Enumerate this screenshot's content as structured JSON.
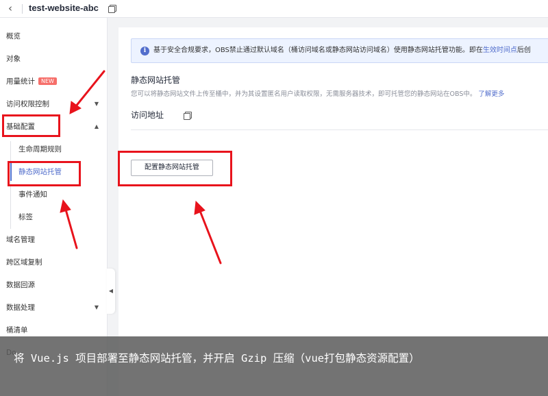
{
  "topbar": {
    "back_glyph": "‹",
    "title": "test-website-abc",
    "copy_icon": "copy-icon"
  },
  "sidebar": {
    "items": [
      {
        "label": "概览"
      },
      {
        "label": "对象"
      },
      {
        "label": "用量统计",
        "badge": "NEW"
      },
      {
        "label": "访问权限控制",
        "caret": "▼"
      },
      {
        "label": "基础配置",
        "caret": "▲"
      },
      {
        "label": "生命周期规则"
      },
      {
        "label": "静态网站托管"
      },
      {
        "label": "事件通知"
      },
      {
        "label": "标签"
      },
      {
        "label": "域名管理"
      },
      {
        "label": "跨区域复制"
      },
      {
        "label": "数据回源"
      },
      {
        "label": "数据处理",
        "caret": "▼"
      },
      {
        "label": "桶清单"
      },
      {
        "label": "Do"
      }
    ],
    "collapse_glyph": "◀"
  },
  "notice": {
    "icon": "info-icon",
    "text": "基于安全合规要求，OBS禁止通过默认域名（桶访问域名或静态网站访问域名）使用静态网站托管功能。即在",
    "link": "生效时间点",
    "tail": "后创"
  },
  "section": {
    "title": "静态网站托管",
    "desc": "您可以将静态网站文件上传至桶中，并为其设置匿名用户读取权限，无需服务器技术，即可托管您的静态网站在OBS中。",
    "learn_more": "了解更多",
    "access_label": "访问地址"
  },
  "config_button": "配置静态网站托管",
  "caption": "将 Vue.js 项目部署至静态网站托管，并开启 Gzip 压缩（vue打包静态资源配置）",
  "colors": {
    "accent": "#526ecc",
    "highlight": "#e8131c",
    "badge": "#f66f6a"
  }
}
